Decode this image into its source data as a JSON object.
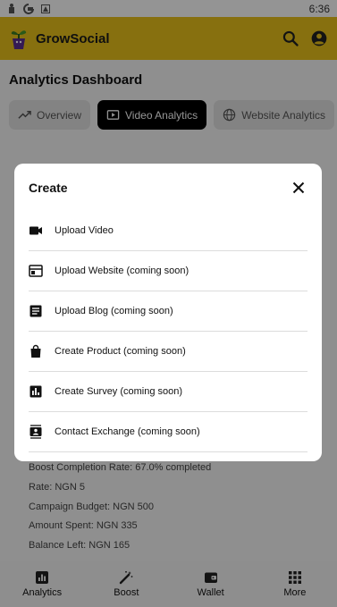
{
  "status_bar": {
    "time": "6:36"
  },
  "app_bar": {
    "title": "GrowSocial",
    "brand_color": "#e8c21a"
  },
  "page": {
    "title": "Analytics Dashboard",
    "tabs": [
      {
        "label": "Overview",
        "icon": "trending-up-icon",
        "active": false
      },
      {
        "label": "Video Analytics",
        "icon": "video-icon",
        "active": true
      },
      {
        "label": "Website Analytics",
        "icon": "globe-icon",
        "active": false
      }
    ]
  },
  "stats": [
    "Boost Completion Rate: 67.0% completed",
    "Rate: NGN 5",
    "Campaign Budget: NGN 500",
    "Amount Spent: NGN 335",
    "Balance Left: NGN 165"
  ],
  "dialog": {
    "title": "Create",
    "items": [
      {
        "label": "Upload Video",
        "icon": "videocam-icon"
      },
      {
        "label": "Upload Website (coming soon)",
        "icon": "web-icon"
      },
      {
        "label": "Upload Blog (coming soon)",
        "icon": "article-icon"
      },
      {
        "label": "Create Product (coming soon)",
        "icon": "shopping-bag-icon"
      },
      {
        "label": "Create Survey (coming soon)",
        "icon": "poll-icon"
      },
      {
        "label": "Contact Exchange (coming soon)",
        "icon": "contact-card-icon"
      }
    ]
  },
  "bottom_nav": [
    {
      "label": "Analytics",
      "icon": "bar-chart-icon"
    },
    {
      "label": "Boost",
      "icon": "magic-wand-icon"
    },
    {
      "label": "Wallet",
      "icon": "wallet-icon"
    },
    {
      "label": "More",
      "icon": "grid-icon"
    }
  ]
}
